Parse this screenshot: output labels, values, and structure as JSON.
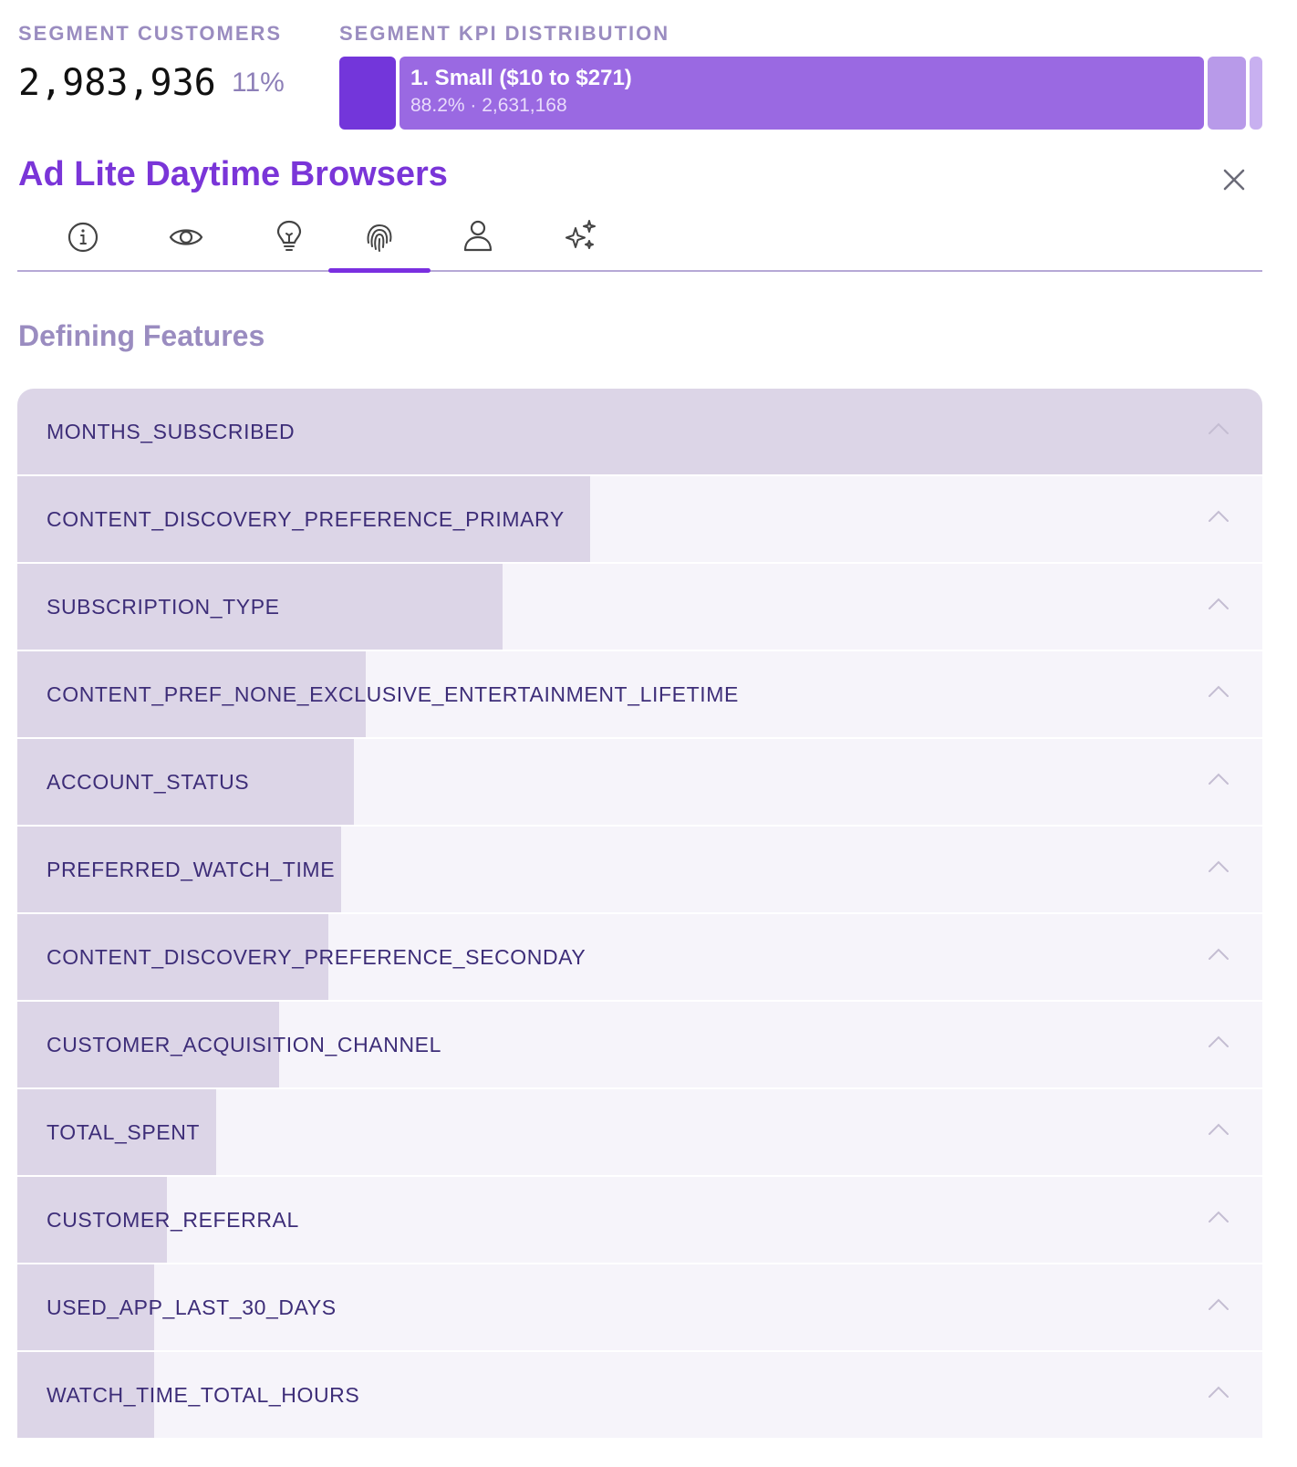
{
  "segment": {
    "customers_label": "SEGMENT CUSTOMERS",
    "customers_value": "2,983,936",
    "customers_pct": "11%",
    "kpi_label": "SEGMENT KPI DISTRIBUTION",
    "kpi_segment_title": "1. Small ($10 to $271)",
    "kpi_segment_sub": "88.2% · 2,631,168"
  },
  "panel": {
    "title": "Ad Lite Daytime Browsers",
    "close_icon": "close-icon"
  },
  "tabs": [
    {
      "icon": "info-icon",
      "active": false
    },
    {
      "icon": "eye-icon",
      "active": false
    },
    {
      "icon": "lightbulb-icon",
      "active": false
    },
    {
      "icon": "fingerprint-icon",
      "active": true
    },
    {
      "icon": "person-icon",
      "active": false
    },
    {
      "icon": "sparkles-icon",
      "active": false
    }
  ],
  "features": {
    "heading": "Defining Features",
    "items": [
      {
        "label": "MONTHS_SUBSCRIBED",
        "importance": 1.0
      },
      {
        "label": "CONTENT_DISCOVERY_PREFERENCE_PRIMARY",
        "importance": 0.46
      },
      {
        "label": "SUBSCRIPTION_TYPE",
        "importance": 0.39
      },
      {
        "label": "CONTENT_PREF_NONE_EXCLUSIVE_ENTERTAINMENT_LIFETIME",
        "importance": 0.28
      },
      {
        "label": "ACCOUNT_STATUS",
        "importance": 0.27
      },
      {
        "label": "PREFERRED_WATCH_TIME",
        "importance": 0.26
      },
      {
        "label": "CONTENT_DISCOVERY_PREFERENCE_SECONDAY",
        "importance": 0.25
      },
      {
        "label": "CUSTOMER_ACQUISITION_CHANNEL",
        "importance": 0.21
      },
      {
        "label": "TOTAL_SPENT",
        "importance": 0.16
      },
      {
        "label": "CUSTOMER_REFERRAL",
        "importance": 0.12
      },
      {
        "label": "USED_APP_LAST_30_DAYS",
        "importance": 0.11
      },
      {
        "label": "WATCH_TIME_TOTAL_HOURS",
        "importance": 0.11
      }
    ]
  },
  "colors": {
    "accent": "#7a35d8",
    "tab_underline": "#7a2fe0",
    "bar_fill": "#dcd5e7",
    "row_bg": "#f6f4fa"
  }
}
